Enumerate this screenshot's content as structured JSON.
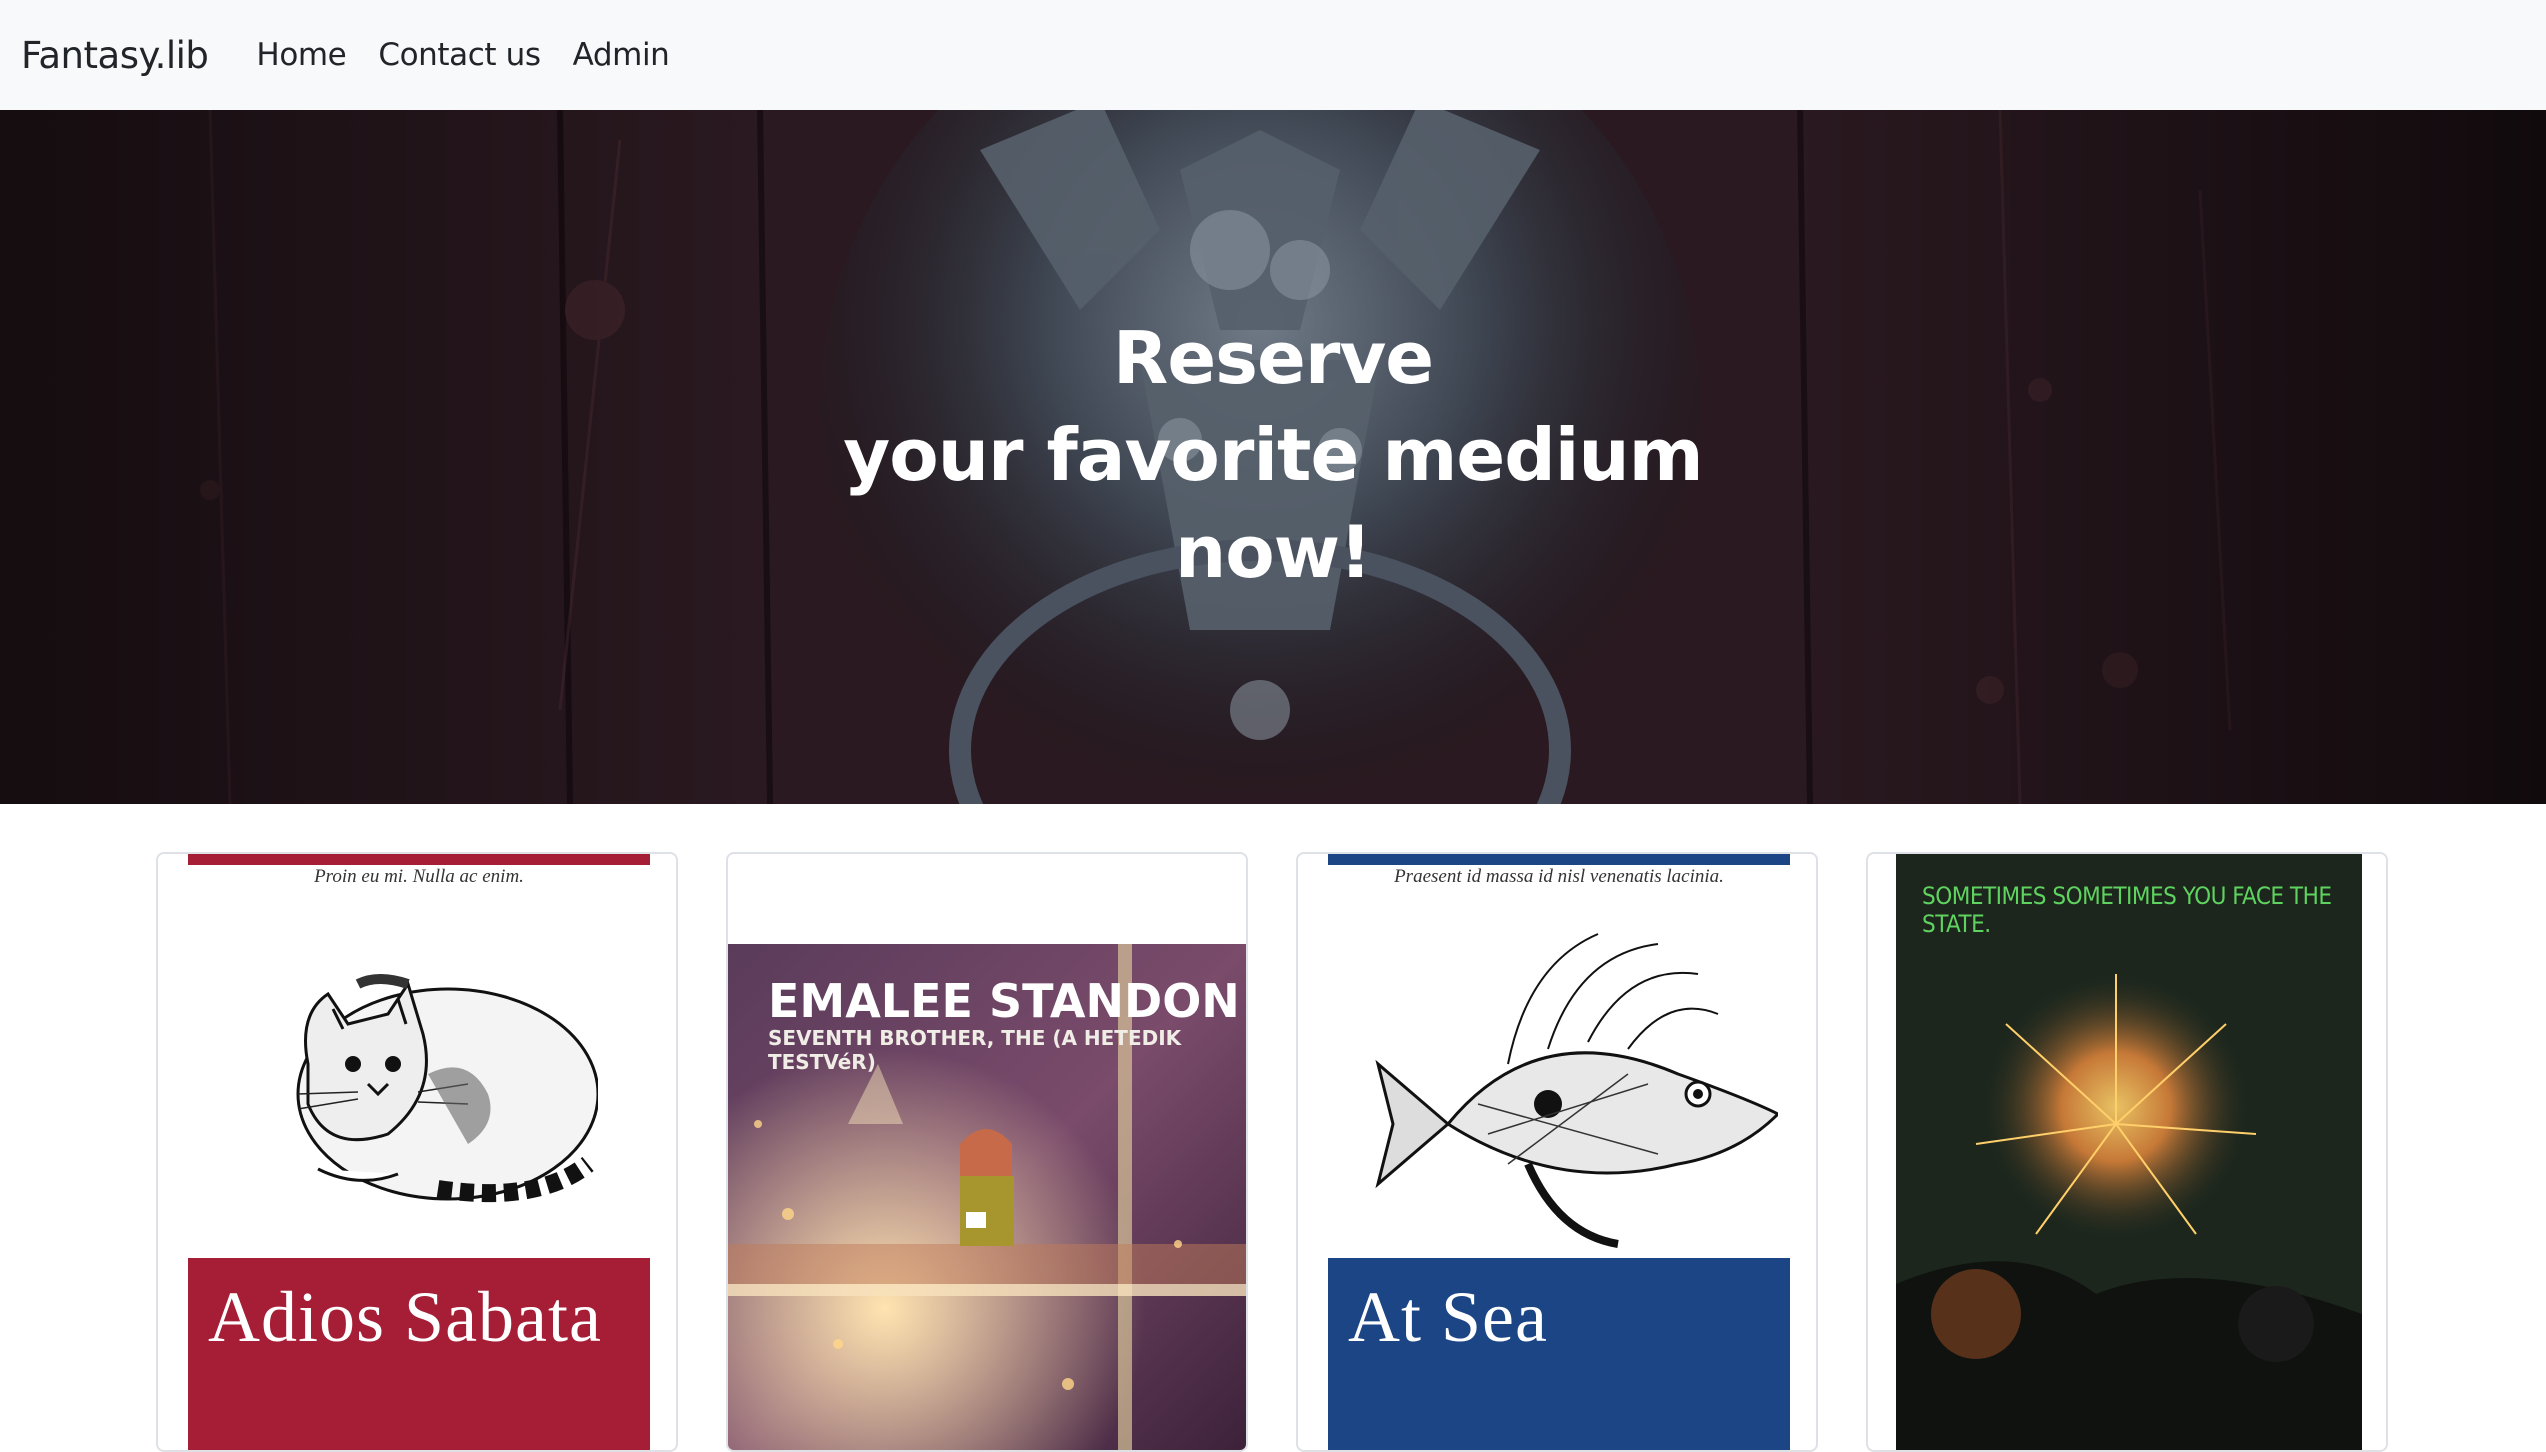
{
  "navbar": {
    "brand": "Fantasy.lib",
    "links": [
      "Home",
      "Contact us",
      "Admin"
    ]
  },
  "hero": {
    "title_lines": [
      "Reserve",
      "your favorite medium",
      "now!"
    ]
  },
  "books": [
    {
      "cover_style": "oreilly-cat",
      "accent_color": "#a51e36",
      "tagline": "Proin eu mi. Nulla ac enim.",
      "title": "Adios Sabata"
    },
    {
      "cover_style": "poster-cafe",
      "author": "EMALEE STANDON",
      "subtitle": "SEVENTH BROTHER, THE (A HETEDIK TESTVéR)"
    },
    {
      "cover_style": "oreilly-fish",
      "accent_color": "#1b4584",
      "tagline": "Praesent id massa id nisl venenatis lacinia.",
      "title": "At Sea"
    },
    {
      "cover_style": "poster-fireworks",
      "tagline": "SOMETIMES SOMETIMES YOU FACE THE STATE."
    }
  ]
}
